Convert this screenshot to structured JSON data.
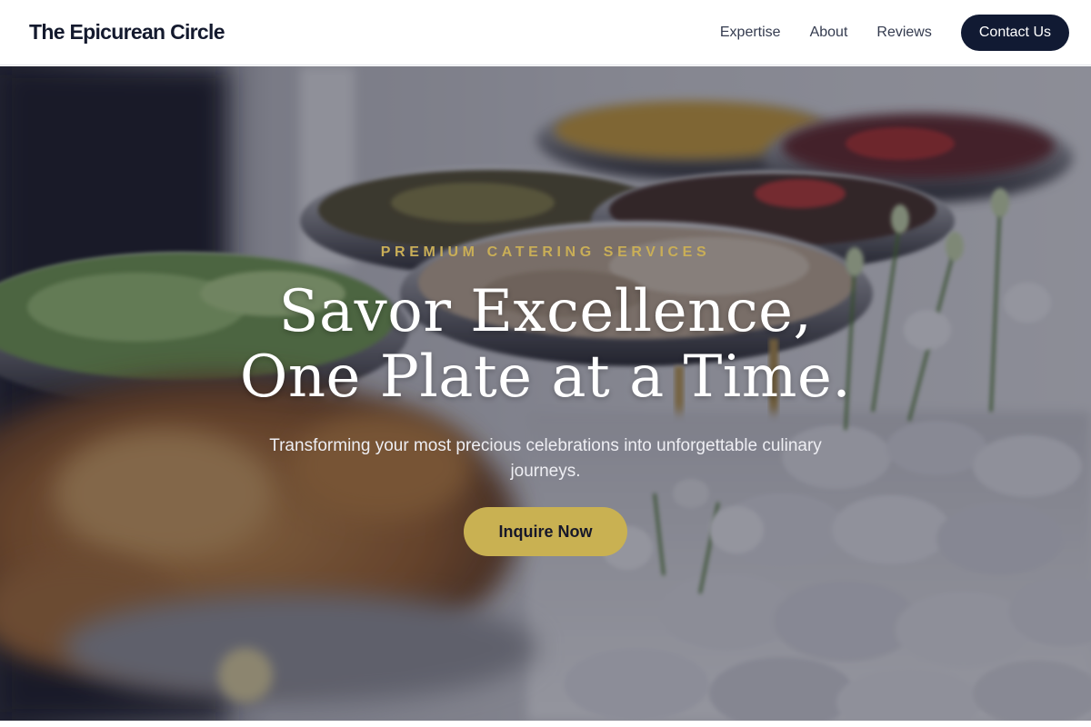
{
  "header": {
    "brand": "The Epicurean Circle",
    "nav": [
      {
        "label": "Expertise"
      },
      {
        "label": "About"
      },
      {
        "label": "Reviews"
      }
    ],
    "contact_label": "Contact Us"
  },
  "hero": {
    "eyebrow": "PREMIUM CATERING SERVICES",
    "headline_line1": "Savor Excellence,",
    "headline_line2": "One Plate at a Time.",
    "subtitle": "Transforming your most precious celebrations into unforgettable culinary journeys.",
    "cta_label": "Inquire Now"
  },
  "colors": {
    "brand_navy": "#111a33",
    "accent_gold": "#c9b152",
    "eyebrow_gold": "#c9ae57"
  }
}
